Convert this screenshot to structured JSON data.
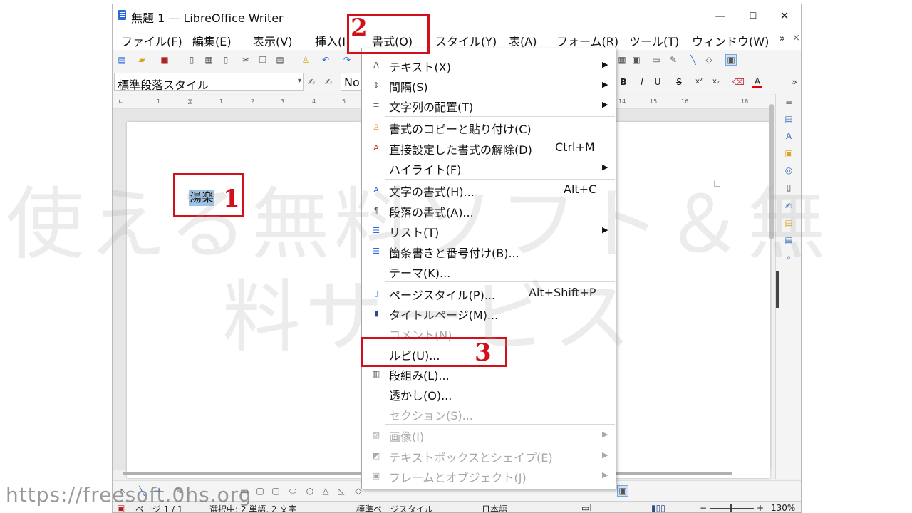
{
  "window": {
    "title": "無題 1 — LibreOffice Writer",
    "controls": {
      "minimize": "—",
      "maximize": "☐",
      "close": "✕"
    }
  },
  "menubar": {
    "items": [
      "ファイル(F)",
      "編集(E)",
      "表示(V)",
      "挿入(I",
      "書式(O)",
      "スタイル(Y)",
      "表(A)",
      "フォーム(R)",
      "ツール(T)",
      "ウィンドウ(W)"
    ],
    "overflow": "»",
    "close": "×"
  },
  "toolbar2": {
    "paragraph_style": "標準段落スタイル",
    "font_name": "No",
    "bold": "B",
    "italic": "I",
    "underline": "U",
    "strike": "S",
    "superscript": "x²",
    "subscript": "x₂",
    "font_color": "A",
    "overflow": "»"
  },
  "ruler": {
    "ticks": [
      "1",
      "1",
      "2",
      "3",
      "4",
      "5",
      "14",
      "15",
      "16",
      "18"
    ]
  },
  "document": {
    "selected_text": "湯楽"
  },
  "format_menu": {
    "items": [
      {
        "icon": "text-icon",
        "label": "テキスト(X)",
        "shortcut": "",
        "submenu": true,
        "enabled": true
      },
      {
        "icon": "spacing-icon",
        "label": "間隔(S)",
        "shortcut": "",
        "submenu": true,
        "enabled": true
      },
      {
        "icon": "align-icon",
        "label": "文字列の配置(T)",
        "shortcut": "",
        "submenu": true,
        "enabled": true
      },
      {
        "icon": "clone-format-icon",
        "label": "書式のコピーと貼り付け(C)",
        "shortcut": "",
        "submenu": false,
        "enabled": true
      },
      {
        "icon": "clear-format-icon",
        "label": "直接設定した書式の解除(D)",
        "shortcut": "Ctrl+M",
        "submenu": false,
        "enabled": true
      },
      {
        "icon": "",
        "label": "ハイライト(F)",
        "shortcut": "",
        "submenu": true,
        "enabled": true
      },
      {
        "icon": "character-icon",
        "label": "文字の書式(H)...",
        "shortcut": "Alt+C",
        "submenu": false,
        "enabled": true
      },
      {
        "icon": "paragraph-icon",
        "label": "段落の書式(A)...",
        "shortcut": "",
        "submenu": false,
        "enabled": true
      },
      {
        "icon": "list-icon",
        "label": "リスト(T)",
        "shortcut": "",
        "submenu": true,
        "enabled": true
      },
      {
        "icon": "bullets-icon",
        "label": "箇条書きと番号付け(B)...",
        "shortcut": "",
        "submenu": false,
        "enabled": true
      },
      {
        "icon": "",
        "label": "テーマ(K)...",
        "shortcut": "",
        "submenu": false,
        "enabled": true
      },
      {
        "icon": "page-style-icon",
        "label": "ページスタイル(P)...",
        "shortcut": "Alt+Shift+P",
        "submenu": false,
        "enabled": true
      },
      {
        "icon": "title-page-icon",
        "label": "タイトルページ(M)...",
        "shortcut": "",
        "submenu": false,
        "enabled": true
      },
      {
        "icon": "",
        "label": "コメント(N)...",
        "shortcut": "",
        "submenu": false,
        "enabled": false
      },
      {
        "icon": "",
        "label": "ルビ(U)...",
        "shortcut": "",
        "submenu": false,
        "enabled": true
      },
      {
        "icon": "columns-icon",
        "label": "段組み(L)...",
        "shortcut": "",
        "submenu": false,
        "enabled": true
      },
      {
        "icon": "",
        "label": "透かし(O)...",
        "shortcut": "",
        "submenu": false,
        "enabled": true
      },
      {
        "icon": "",
        "label": "セクション(S)...",
        "shortcut": "",
        "submenu": false,
        "enabled": false
      },
      {
        "icon": "image-icon",
        "label": "画像(I)",
        "shortcut": "",
        "submenu": true,
        "enabled": false
      },
      {
        "icon": "shape-icon",
        "label": "テキストボックスとシェイプ(E)",
        "shortcut": "",
        "submenu": true,
        "enabled": false
      },
      {
        "icon": "frame-icon",
        "label": "フレームとオブジェクト(J)",
        "shortcut": "",
        "submenu": true,
        "enabled": false
      }
    ]
  },
  "statusbar": {
    "page": "ページ 1 / 1",
    "selection": "選択中: 2 単語, 2 文字",
    "page_style": "標準ページスタイル",
    "language": "日本語",
    "zoom": "130%"
  },
  "annotations": {
    "step1": "1",
    "step2": "2",
    "step3": "3",
    "color": "#d0101a"
  },
  "watermark": {
    "line1": "使える無料ソフト＆無",
    "line2": "料サービス",
    "url": "https://freesoft.0hs.org"
  }
}
